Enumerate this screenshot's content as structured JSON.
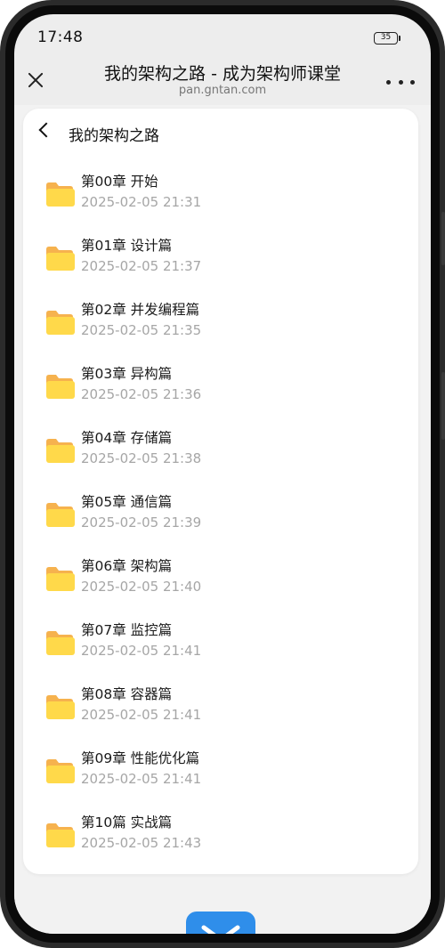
{
  "status_bar": {
    "time": "17:48",
    "battery": "35"
  },
  "title_bar": {
    "title": "我的架构之路 - 成为架构师课堂",
    "domain": "pan.gntan.com"
  },
  "folder": {
    "title": "我的架构之路"
  },
  "items": [
    {
      "name": "第00章 开始",
      "date": "2025-02-05 21:31"
    },
    {
      "name": "第01章 设计篇",
      "date": "2025-02-05 21:37"
    },
    {
      "name": "第02章 并发编程篇",
      "date": "2025-02-05 21:35"
    },
    {
      "name": "第03章 异构篇",
      "date": "2025-02-05 21:36"
    },
    {
      "name": "第04章 存储篇",
      "date": "2025-02-05 21:38"
    },
    {
      "name": "第05章 通信篇",
      "date": "2025-02-05 21:39"
    },
    {
      "name": "第06章 架构篇",
      "date": "2025-02-05 21:40"
    },
    {
      "name": "第07章 监控篇",
      "date": "2025-02-05 21:41"
    },
    {
      "name": "第08章 容器篇",
      "date": "2025-02-05 21:41"
    },
    {
      "name": "第09章 性能优化篇",
      "date": "2025-02-05 21:41"
    },
    {
      "name": "第10篇 实战篇",
      "date": "2025-02-05 21:43"
    }
  ],
  "colors": {
    "folder_front": "#FFD94A",
    "folder_back": "#F6B24E",
    "fab": "#2F8EEA"
  }
}
